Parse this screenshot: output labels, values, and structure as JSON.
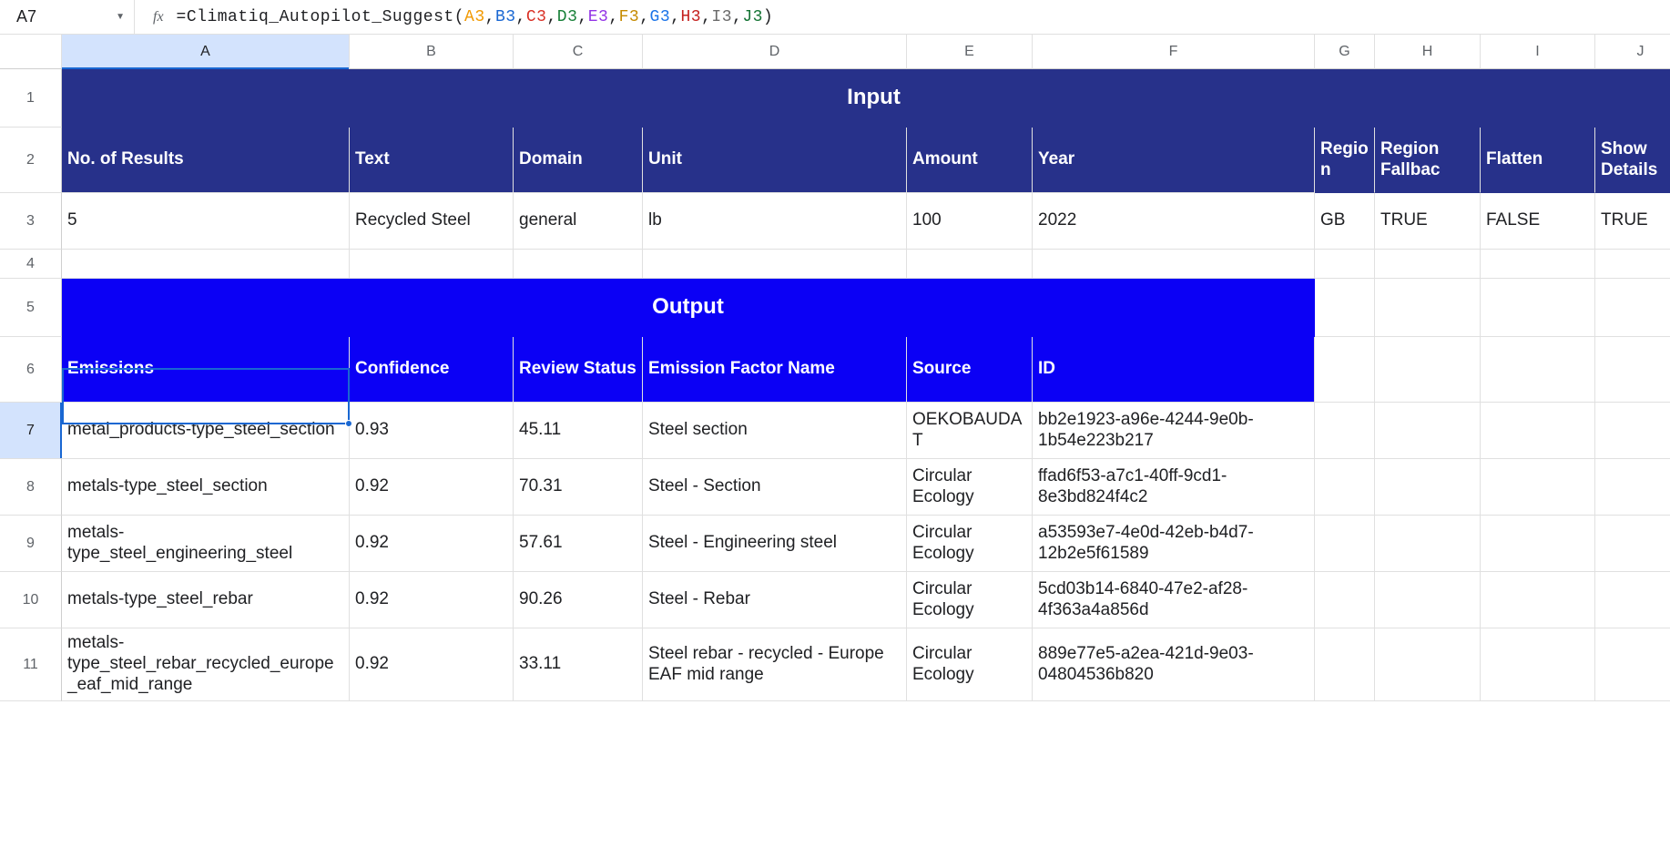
{
  "formula_bar": {
    "cell_ref": "A7",
    "fx_label": "fx",
    "fn": "=Climatiq_Autopilot_Suggest",
    "args": [
      "A3",
      "B3",
      "C3",
      "D3",
      "E3",
      "F3",
      "G3",
      "H3",
      "I3",
      "J3"
    ]
  },
  "columns": [
    "A",
    "B",
    "C",
    "D",
    "E",
    "F",
    "G",
    "H",
    "I",
    "J"
  ],
  "rows": [
    "1",
    "2",
    "3",
    "4",
    "5",
    "6",
    "7",
    "8",
    "9",
    "10",
    "11"
  ],
  "section_headers": {
    "input": "Input",
    "output": "Output"
  },
  "input_headers": {
    "a": "No. of Results",
    "b": "Text",
    "c": "Domain",
    "d": "Unit",
    "e": "Amount",
    "f": "Year",
    "g": "Region",
    "h": "Region Fallbac",
    "i": "Flatten",
    "j": "Show Details"
  },
  "input_row": {
    "a": "5",
    "b": "Recycled Steel",
    "c": "general",
    "d": "lb",
    "e": "100",
    "f": "2022",
    "g": "GB",
    "h": "TRUE",
    "i": "FALSE",
    "j": "TRUE"
  },
  "output_headers": {
    "a": "Emissions",
    "b": "Confidence",
    "c": "Review Status",
    "d": "Emission Factor Name",
    "e": "Source",
    "f": "ID"
  },
  "output_rows": [
    {
      "a": "metal_products-type_steel_section",
      "b": "0.93",
      "c": "45.11",
      "d": "Steel section",
      "e": "OEKOBAUDAT",
      "f": "bb2e1923-a96e-4244-9e0b-1b54e223b217"
    },
    {
      "a": "metals-type_steel_section",
      "b": "0.92",
      "c": "70.31",
      "d": "Steel - Section",
      "e": "Circular Ecology",
      "f": "ffad6f53-a7c1-40ff-9cd1-8e3bd824f4c2"
    },
    {
      "a": "metals-type_steel_engineering_steel",
      "b": "0.92",
      "c": "57.61",
      "d": "Steel - Engineering steel",
      "e": "Circular Ecology",
      "f": "a53593e7-4e0d-42eb-b4d7-12b2e5f61589"
    },
    {
      "a": "metals-type_steel_rebar",
      "b": "0.92",
      "c": "90.26",
      "d": "Steel - Rebar",
      "e": "Circular Ecology",
      "f": "5cd03b14-6840-47e2-af28-4f363a4a856d"
    },
    {
      "a": "metals-type_steel_rebar_recycled_europe_eaf_mid_range",
      "b": "0.92",
      "c": "33.11",
      "d": "Steel rebar - recycled - Europe EAF mid range",
      "e": "Circular Ecology",
      "f": "889e77e5-a2ea-421d-9e03-04804536b820"
    }
  ],
  "chart_data": {
    "type": "table",
    "title": "Climatiq Autopilot Suggest – Recycled Steel",
    "input": {
      "No. of Results": 5,
      "Text": "Recycled Steel",
      "Domain": "general",
      "Unit": "lb",
      "Amount": 100,
      "Year": 2022,
      "Region": "GB",
      "Region Fallback": true,
      "Flatten": false,
      "Show Details": true
    },
    "columns": [
      "Emissions",
      "Confidence",
      "Review Status",
      "Emission Factor Name",
      "Source",
      "ID"
    ],
    "rows": [
      [
        "metal_products-type_steel_section",
        0.93,
        45.11,
        "Steel section",
        "OEKOBAUDAT",
        "bb2e1923-a96e-4244-9e0b-1b54e223b217"
      ],
      [
        "metals-type_steel_section",
        0.92,
        70.31,
        "Steel - Section",
        "Circular Ecology",
        "ffad6f53-a7c1-40ff-9cd1-8e3bd824f4c2"
      ],
      [
        "metals-type_steel_engineering_steel",
        0.92,
        57.61,
        "Steel - Engineering steel",
        "Circular Ecology",
        "a53593e7-4e0d-42eb-b4d7-12b2e5f61589"
      ],
      [
        "metals-type_steel_rebar",
        0.92,
        90.26,
        "Steel - Rebar",
        "Circular Ecology",
        "5cd03b14-6840-47e2-af28-4f363a4a856d"
      ],
      [
        "metals-type_steel_rebar_recycled_europe_eaf_mid_range",
        0.92,
        33.11,
        "Steel rebar - recycled - Europe EAF mid range",
        "Circular Ecology",
        "889e77e5-a2ea-421d-9e03-04804536b820"
      ]
    ]
  }
}
